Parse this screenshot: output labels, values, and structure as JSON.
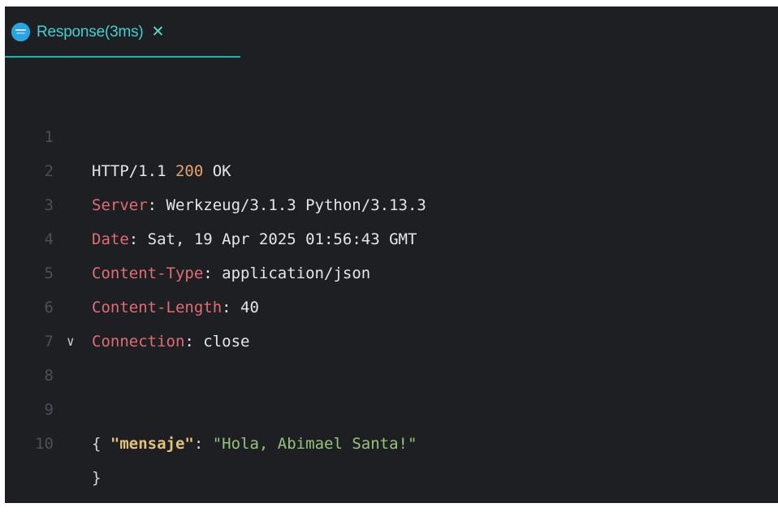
{
  "tab": {
    "label": "Response(3ms)",
    "close_glyph": "✕",
    "icon": "api-client-globe-icon"
  },
  "colors": {
    "background": "#1e1f22",
    "accent": "#16b5b5",
    "header_key": "#e06c75",
    "status_code": "#e5a56a",
    "json_key": "#e5c07b",
    "json_string": "#98c379",
    "line_number": "#4b5058"
  },
  "lines": [
    {
      "num": "1",
      "prefix": "HTTP/1.1 ",
      "code": "200",
      "suffix": " OK"
    },
    {
      "num": "2",
      "key": "Server",
      "sep": ": ",
      "value": "Werkzeug/3.1.3 Python/3.13.3"
    },
    {
      "num": "3",
      "key": "Date",
      "sep": ": ",
      "value": "Sat, 19 Apr 2025 01:56:43 GMT"
    },
    {
      "num": "4",
      "key": "Content-Type",
      "sep": ": ",
      "value": "application/json"
    },
    {
      "num": "5",
      "key": "Content-Length",
      "sep": ": ",
      "value": "40"
    },
    {
      "num": "6",
      "key": "Connection",
      "sep": ": ",
      "value": "close"
    },
    {
      "num": "7"
    },
    {
      "num": "8",
      "text": "{",
      "fold": "∨"
    },
    {
      "num": "9",
      "indent": "  ",
      "key": "\"mensaje\"",
      "sep": ": ",
      "value": "\"Hola, Abimael Santa!\""
    },
    {
      "num": "10",
      "text": "}"
    }
  ]
}
